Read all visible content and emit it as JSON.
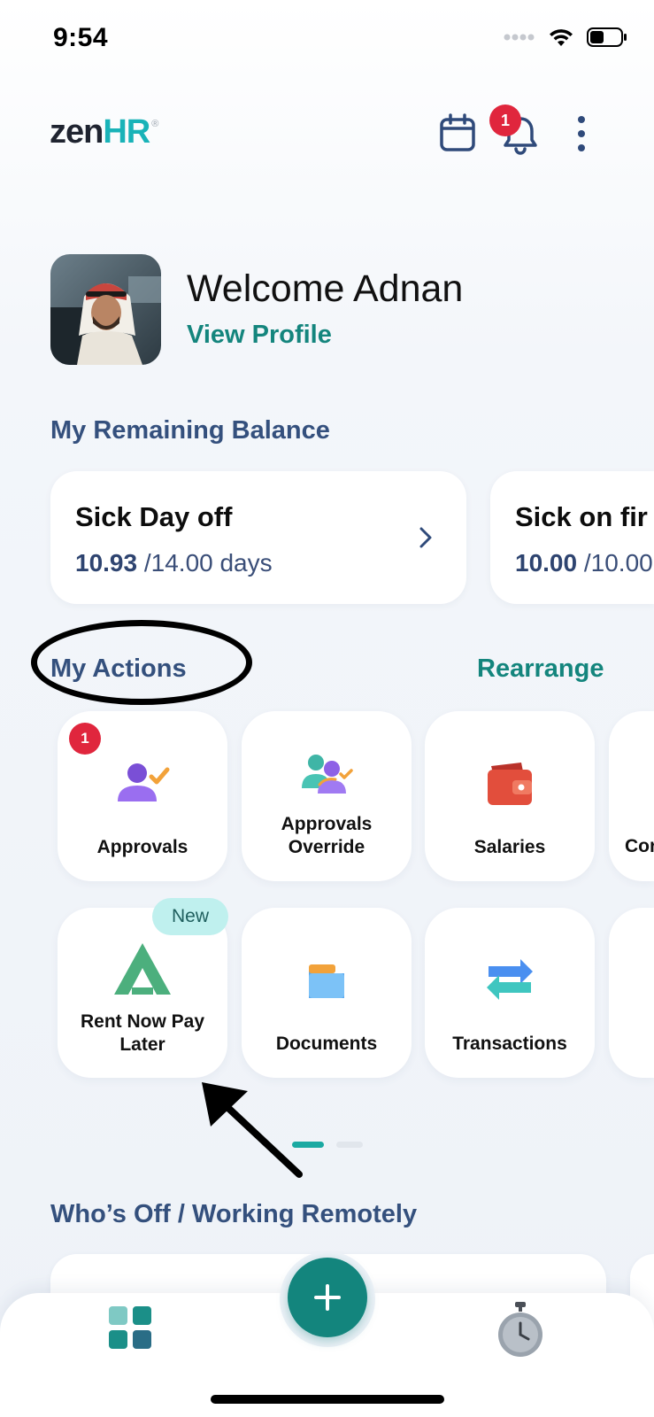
{
  "status_bar": {
    "time": "9:54"
  },
  "header": {
    "logo": {
      "part1": "zen",
      "part2": "HR",
      "mark": "®"
    },
    "notification_count": "1",
    "icons": [
      "calendar-icon",
      "bell-icon",
      "more-vertical-icon"
    ]
  },
  "profile": {
    "welcome": "Welcome Adnan",
    "view_profile": "View Profile"
  },
  "balance": {
    "title": "My Remaining Balance",
    "cards": [
      {
        "title": "Sick Day off",
        "used": "10.93",
        "total": "/14.00 days"
      },
      {
        "title": "Sick on fir",
        "used": "10.00",
        "total": "/10.00"
      }
    ]
  },
  "actions": {
    "title": "My Actions",
    "rearrange": "Rearrange",
    "approvals_badge": "1",
    "new_badge": "New",
    "tiles": [
      {
        "label": "Approvals",
        "icon": "user-check-icon"
      },
      {
        "label": "Approvals Override",
        "icon": "users-override-icon"
      },
      {
        "label": "Salaries",
        "icon": "wallet-icon"
      },
      {
        "label": "Cor",
        "icon": ""
      },
      {
        "label": "Rent Now Pay Later",
        "icon": "rent-logo-icon"
      },
      {
        "label": "Documents",
        "icon": "folder-icon"
      },
      {
        "label": "Transactions",
        "icon": "transfer-arrows-icon"
      }
    ]
  },
  "whos_off": {
    "title": "Who’s Off / Working Remotely"
  },
  "bottom_nav": {
    "items": [
      "dashboard-icon",
      "add-icon",
      "stopwatch-icon"
    ]
  },
  "colors": {
    "primary": "#13857d",
    "heading": "#34507d",
    "badge": "#e0263d",
    "teal_logo": "#19b3b8"
  }
}
